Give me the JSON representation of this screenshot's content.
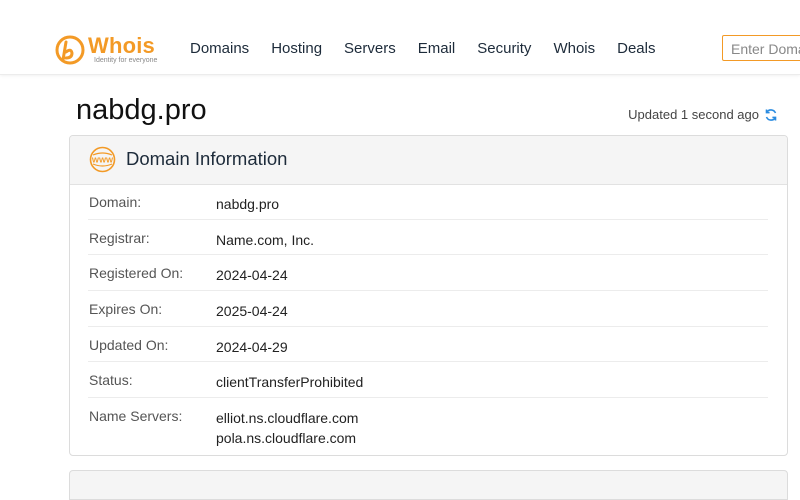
{
  "brand": {
    "name": "Whois",
    "tagline": "Identity for everyone",
    "accent": "#f39a26"
  },
  "nav": {
    "items": [
      "Domains",
      "Hosting",
      "Servers",
      "Email",
      "Security",
      "Whois",
      "Deals"
    ]
  },
  "search": {
    "placeholder": "Enter Domain"
  },
  "page": {
    "title": "nabdg.pro",
    "updated": "Updated 1 second ago"
  },
  "domain_info": {
    "title": "Domain Information",
    "rows": [
      {
        "label": "Domain:",
        "value": "nabdg.pro"
      },
      {
        "label": "Registrar:",
        "value": "Name.com, Inc."
      },
      {
        "label": "Registered On:",
        "value": "2024-04-24"
      },
      {
        "label": "Expires On:",
        "value": "2025-04-24"
      },
      {
        "label": "Updated On:",
        "value": "2024-04-29"
      },
      {
        "label": "Status:",
        "value": "clientTransferProhibited"
      },
      {
        "label": "Name Servers:",
        "values": [
          "elliot.ns.cloudflare.com",
          "pola.ns.cloudflare.com"
        ]
      }
    ]
  },
  "icons": {
    "refresh": "refresh-icon",
    "www": "www-icon",
    "logo": "whois-logo-icon"
  }
}
